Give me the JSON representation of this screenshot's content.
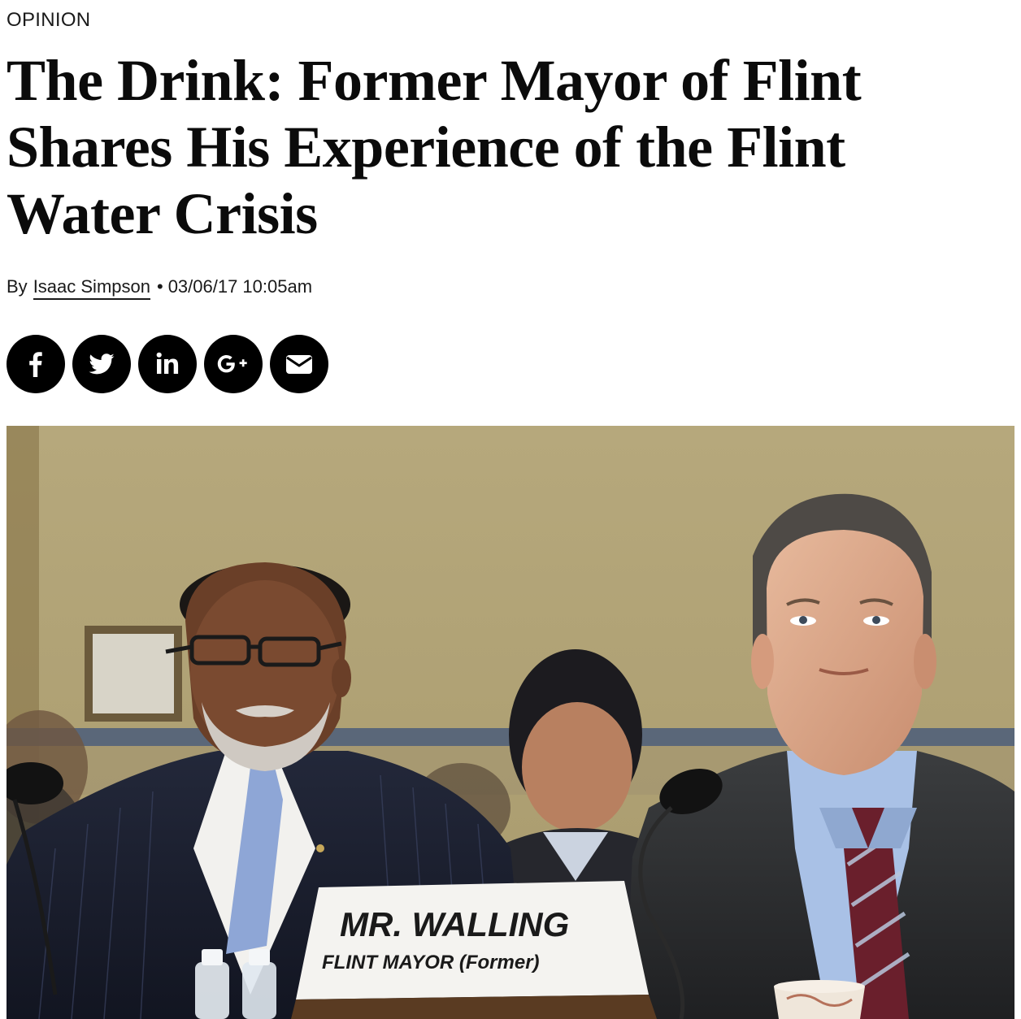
{
  "section": {
    "label": "OPINION"
  },
  "article": {
    "headline": "The Drink: Former Mayor of Flint Shares His Experience of the Flint Water Crisis",
    "byline_prefix": "By",
    "author": "Isaac Simpson",
    "separator": "•",
    "timestamp": "03/06/17 10:05am"
  },
  "share": {
    "buttons": [
      {
        "icon": "facebook-icon"
      },
      {
        "icon": "twitter-icon"
      },
      {
        "icon": "linkedin-icon"
      },
      {
        "icon": "google-plus-icon"
      },
      {
        "icon": "email-icon"
      }
    ]
  },
  "photo": {
    "nameplate_name": "MR. WALLING",
    "nameplate_title": "FLINT MAYOR (Former)"
  },
  "colors": {
    "text": "#0b0b0b",
    "share_button_bg": "#000000",
    "share_icon": "#ffffff",
    "photo_wall": "#b3a578"
  }
}
